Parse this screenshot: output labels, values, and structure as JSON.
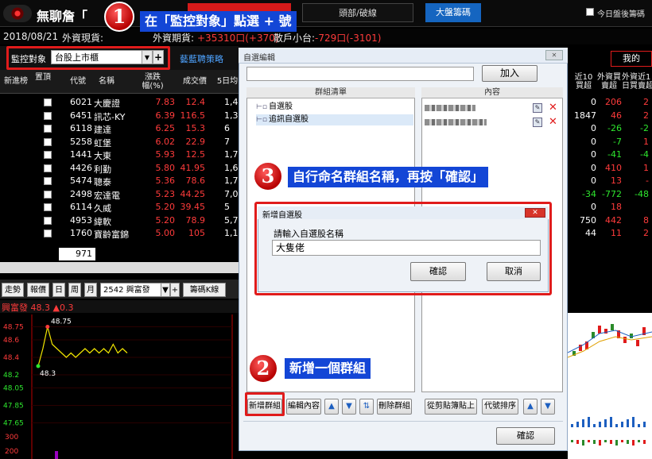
{
  "app": {
    "title": "無聊詹「",
    "tabs": {
      "red": "",
      "breakout": "頭部/破線",
      "chips": "大盤籌碼"
    },
    "after_hours_label": "今日盤後籌碼"
  },
  "status": {
    "date": "2018/08/21",
    "foreign_label": "外資現貨:",
    "futures_label": "外資期貨:",
    "futures_value": "+35310口(+370)",
    "retail_label": "散戶小台:",
    "retail_value": "-729口(-3101)"
  },
  "monitor": {
    "label": "監控對象",
    "selected": "台股上市櫃",
    "strategy_link": "藝藍聘策略"
  },
  "table": {
    "headers": [
      "新進榜",
      "置頂",
      "代號",
      "名稱",
      "漲跌幅(%)",
      "成交價",
      "5日均"
    ],
    "rows": [
      {
        "code": "6021",
        "name": "大慶證",
        "chg": "7.83",
        "price": "12.4",
        "vol": "1,4"
      },
      {
        "code": "6451",
        "name": "訊芯-KY",
        "chg": "6.39",
        "price": "116.5",
        "vol": "1,3"
      },
      {
        "code": "6118",
        "name": "建達",
        "chg": "6.25",
        "price": "15.3",
        "vol": "6"
      },
      {
        "code": "5258",
        "name": "虹堡",
        "chg": "6.02",
        "price": "22.9",
        "vol": "7"
      },
      {
        "code": "1441",
        "name": "大東",
        "chg": "5.93",
        "price": "12.5",
        "vol": "1,7"
      },
      {
        "code": "4426",
        "name": "利勤",
        "chg": "5.80",
        "price": "41.95",
        "vol": "1,6"
      },
      {
        "code": "5474",
        "name": "聰泰",
        "chg": "5.36",
        "price": "78.6",
        "vol": "1,7"
      },
      {
        "code": "2498",
        "name": "宏達電",
        "chg": "5.23",
        "price": "44.25",
        "vol": "7,0"
      },
      {
        "code": "6114",
        "name": "久威",
        "chg": "5.20",
        "price": "39.45",
        "vol": "5"
      },
      {
        "code": "4953",
        "name": "緯軟",
        "chg": "5.20",
        "price": "78.9",
        "vol": "5,7"
      },
      {
        "code": "1760",
        "name": "寶齡富錦",
        "chg": "5.00",
        "price": "105",
        "vol": "1,1"
      }
    ],
    "count": "971"
  },
  "chart_tabs": {
    "items": [
      "走勢",
      "報價",
      "日",
      "周",
      "月"
    ],
    "stock_select": "2542 興富發",
    "kline_btn": "籌碼K線",
    "title_name": "興富發",
    "title_price": "48.3",
    "title_change": "▲0.3"
  },
  "chart_data": {
    "type": "line",
    "y_ticks": [
      "48.75",
      "48.6",
      "48.4",
      "48.2",
      "48.05",
      "47.85",
      "47.65"
    ],
    "volume_ticks": [
      "300",
      "200"
    ],
    "high_label": "48.75",
    "low_label": "48.3",
    "values": [
      48.3,
      48.5,
      48.75,
      48.55,
      48.5,
      48.45,
      48.4,
      48.45,
      48.4,
      48.45,
      48.5,
      48.45,
      48.5,
      48.45,
      48.5,
      48.45,
      48.55,
      48.45,
      48.5,
      48.45
    ],
    "line_color": "#f2e600"
  },
  "right_panel": {
    "my_button": "我的",
    "headers": [
      "近10\n買超",
      "外資買\n賣超",
      "外資近1\n日買賣超"
    ],
    "rows": [
      [
        "0",
        "206",
        "2"
      ],
      [
        "1847",
        "46",
        "2"
      ],
      [
        "0",
        "-26",
        "-2"
      ],
      [
        "0",
        "-7",
        "1"
      ],
      [
        "0",
        "-41",
        "-4"
      ],
      [
        "0",
        "410",
        "1"
      ],
      [
        "0",
        "13",
        "-"
      ],
      [
        "-34",
        "-772",
        "-48"
      ],
      [
        "0",
        "18",
        ""
      ],
      [
        "750",
        "442",
        "8"
      ],
      [
        "44",
        "11",
        "2"
      ]
    ]
  },
  "dialog": {
    "title": "自選編輯",
    "add_button": "加入",
    "group_header": "群組清單",
    "content_header": "內容",
    "groups": [
      "自選股",
      "追訊自選股"
    ],
    "buttons": {
      "new_group": "新增群組",
      "edit_content": "編輯內容",
      "delete_group": "刪除群組",
      "paste": "從剪貼簿貼上",
      "sort": "代號排序",
      "ok": "確認"
    }
  },
  "sub_dialog": {
    "title": "新增自選股",
    "prompt": "請輸入自選股名稱",
    "value": "大隻佬",
    "confirm": "確認",
    "cancel": "取消"
  },
  "callouts": {
    "step1": {
      "num": "1",
      "text": "在「監控對象」點選 + 號"
    },
    "step2": {
      "num": "2",
      "text": "新增一個群組"
    },
    "step3": {
      "num": "3",
      "text": "自行命名群組名稱，再按「確認」"
    }
  }
}
